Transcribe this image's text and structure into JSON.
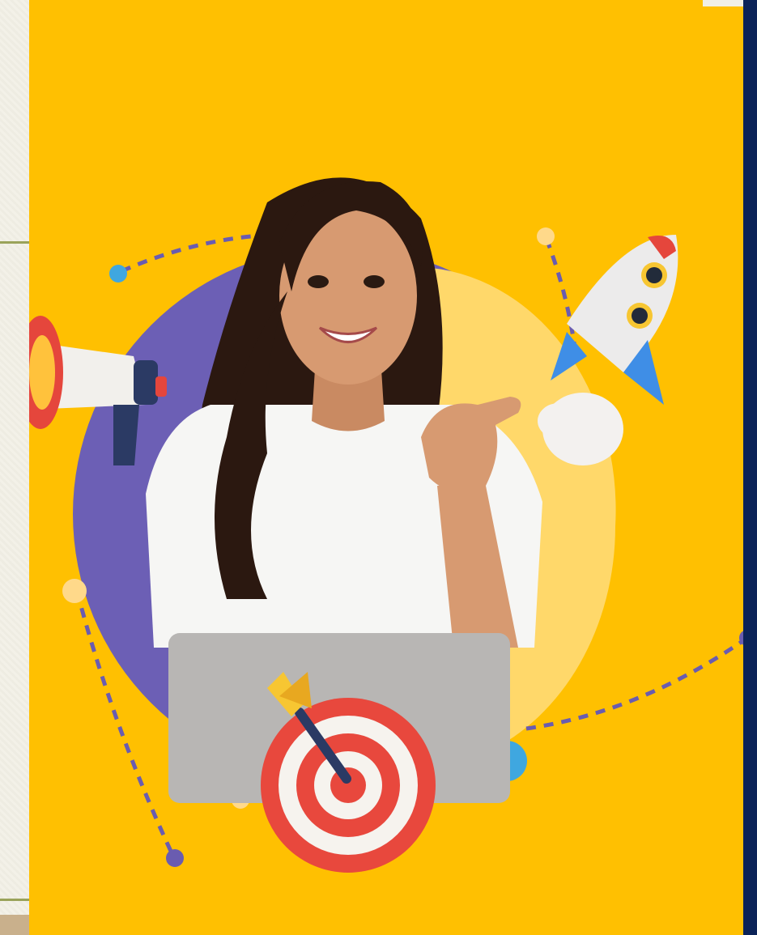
{
  "image": {
    "description_icons": [
      "megaphone-icon",
      "rocket-icon",
      "dart-target-icon",
      "laptop-icon"
    ],
    "colors": {
      "card_background": "#ffc001",
      "purple_circle": "#6c5fb5",
      "light_circle": "#ffd86a",
      "side_bar": "#0b2358",
      "dot_blue": "#3fa7e0",
      "dot_purple": "#6a5cb0",
      "dot_yellow": "#ffd98a"
    }
  }
}
